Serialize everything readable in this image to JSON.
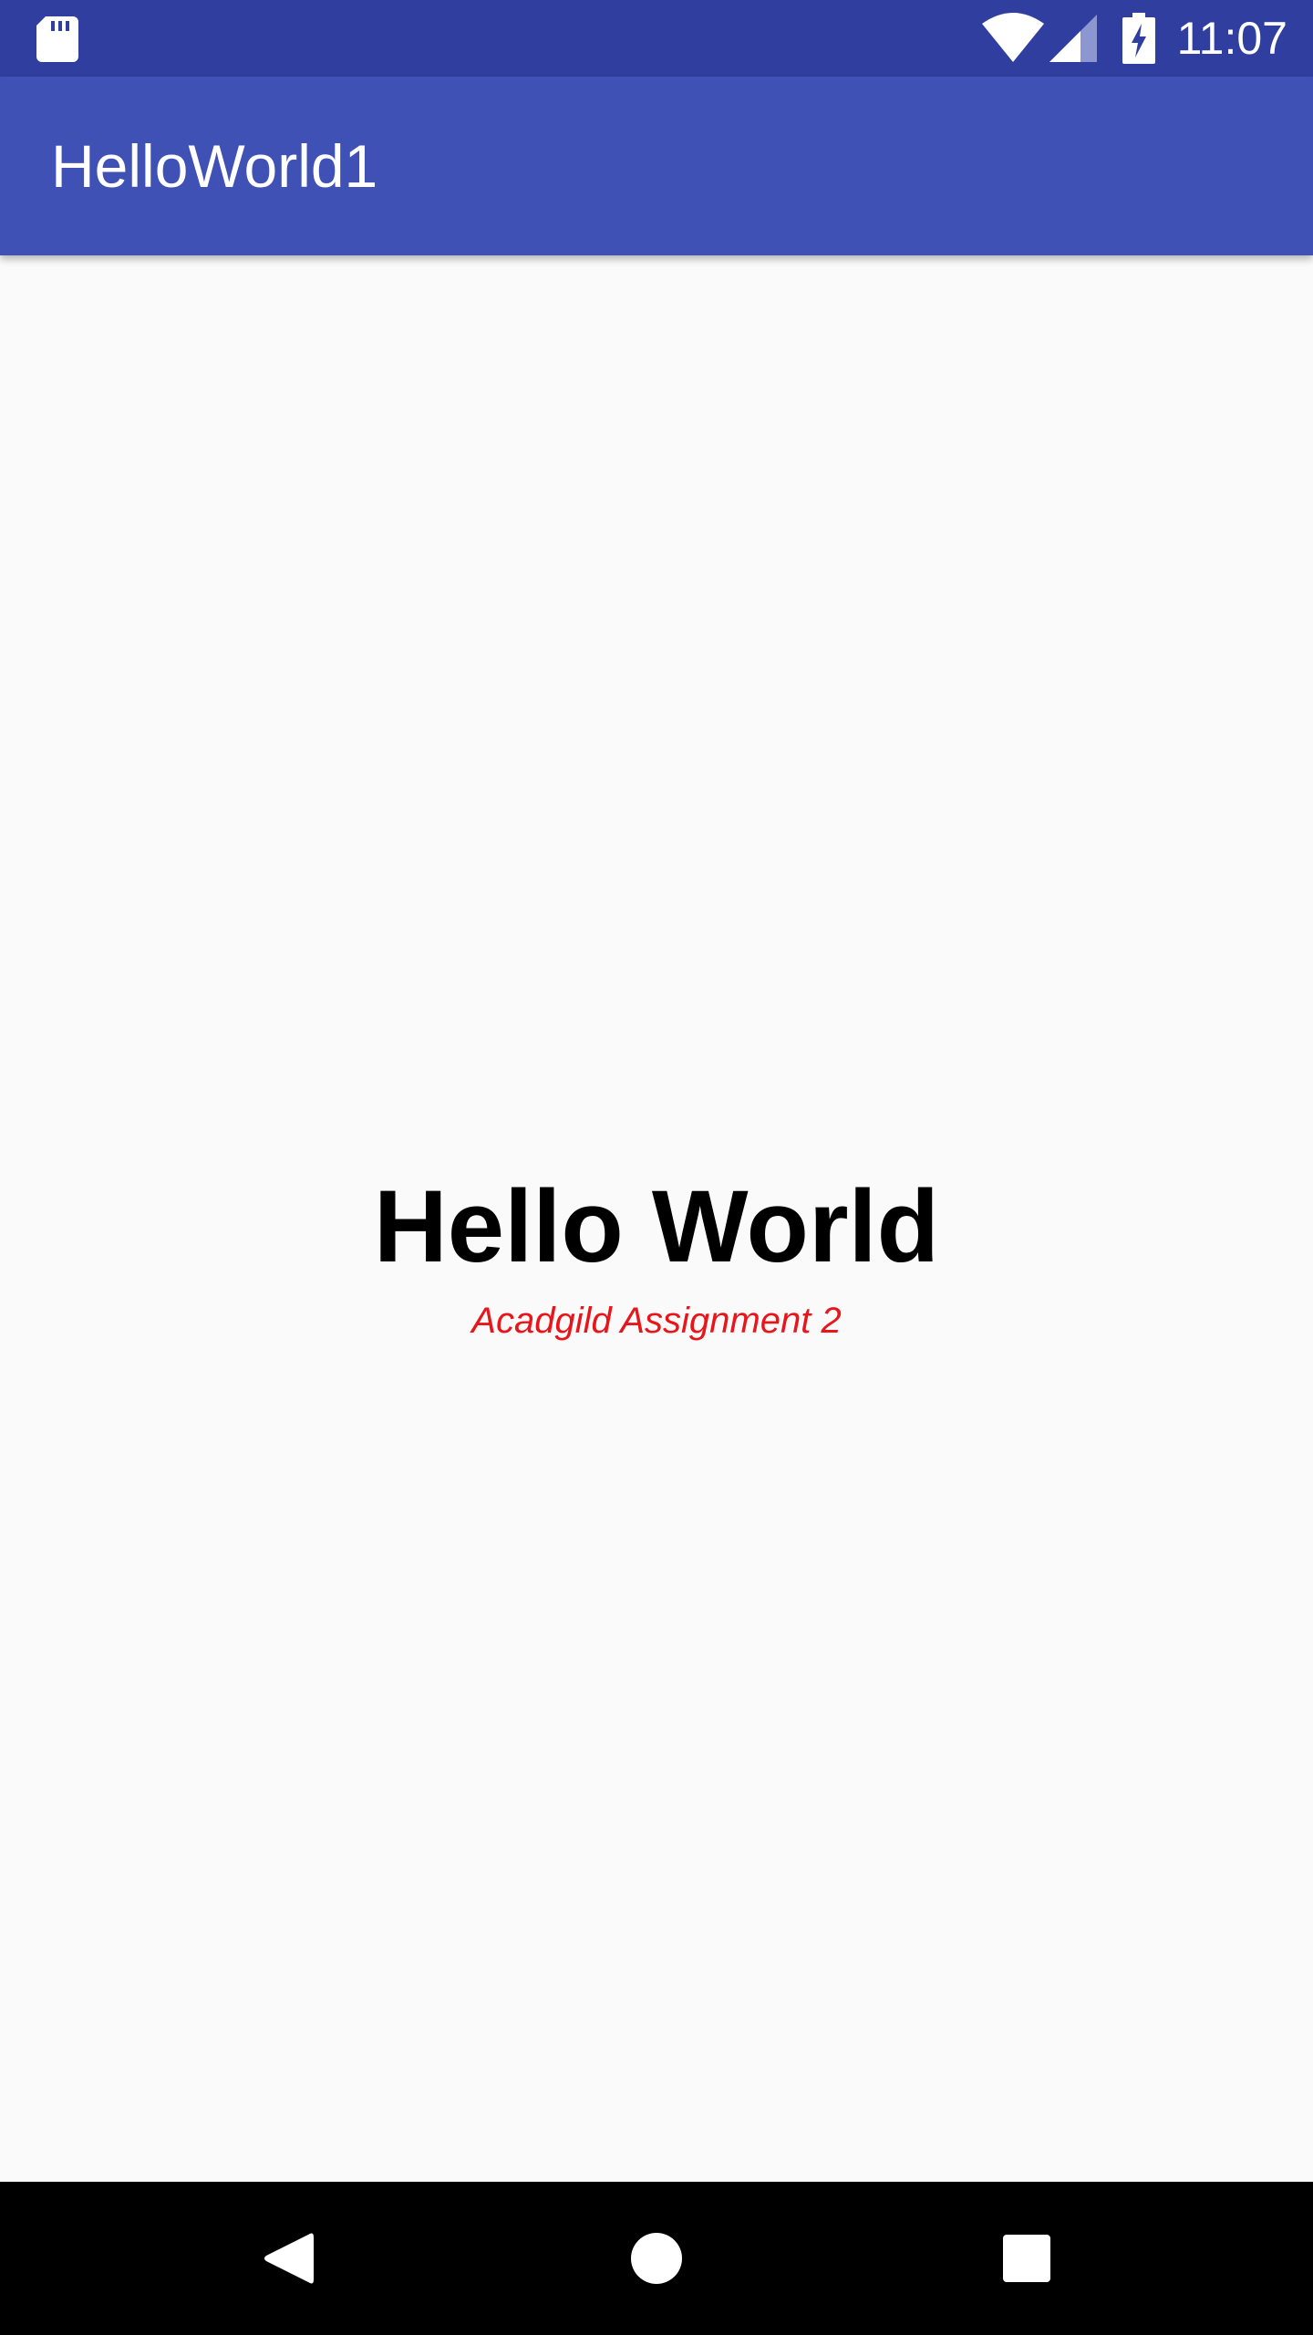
{
  "status_bar": {
    "time": "11:07",
    "icons": [
      "sd-card-icon",
      "wifi-icon",
      "signal-icon",
      "battery-charging-icon"
    ],
    "background": "#303f9f"
  },
  "app_bar": {
    "title": "HelloWorld1",
    "background": "#3f51b5"
  },
  "content": {
    "heading": "Hello World",
    "subtitle": "Acadgild Assignment 2",
    "subtitle_color": "#e8151b"
  },
  "nav_bar": {
    "buttons": [
      "back-icon",
      "home-icon",
      "recents-icon"
    ]
  }
}
